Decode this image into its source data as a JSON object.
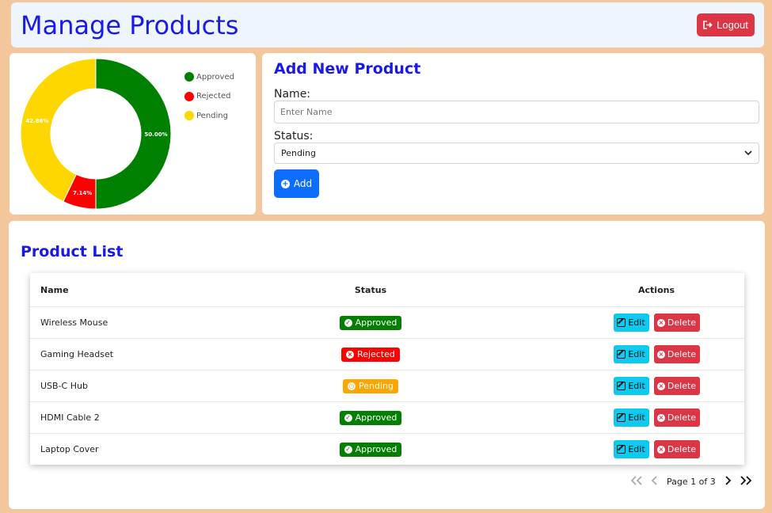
{
  "header": {
    "title": "Manage Products",
    "logout_label": "Logout"
  },
  "chart_data": {
    "type": "pie",
    "donut": true,
    "legend_position": "right",
    "labels": [
      "Approved",
      "Rejected",
      "Pending"
    ],
    "values": [
      50.0,
      7.14,
      42.86
    ],
    "value_labels": [
      "50.00%",
      "7.14%",
      "42.86%"
    ],
    "colors": [
      "#008000",
      "#ff0000",
      "#ffd700"
    ]
  },
  "form": {
    "heading": "Add New Product",
    "name_label": "Name:",
    "name_placeholder": "Enter Name",
    "status_label": "Status:",
    "status_value": "Pending",
    "add_label": "Add"
  },
  "list": {
    "heading": "Product List",
    "columns": [
      "Name",
      "Status",
      "Actions"
    ],
    "rows": [
      {
        "name": "Wireless Mouse",
        "status": "Approved"
      },
      {
        "name": "Gaming Headset",
        "status": "Rejected"
      },
      {
        "name": "USB-C Hub",
        "status": "Pending"
      },
      {
        "name": "HDMI Cable 2",
        "status": "Approved"
      },
      {
        "name": "Laptop Cover",
        "status": "Approved"
      }
    ],
    "edit_label": "Edit",
    "delete_label": "Delete",
    "status_colors": {
      "Approved": "#008000",
      "Rejected": "#ff0000",
      "Pending": "#ffa500"
    }
  },
  "pagination": {
    "label": "Page 1 of 3",
    "first_icon": "double-chevron-left-icon",
    "prev_icon": "chevron-left-icon",
    "next_icon": "chevron-right-icon",
    "last_icon": "double-chevron-right-icon"
  }
}
